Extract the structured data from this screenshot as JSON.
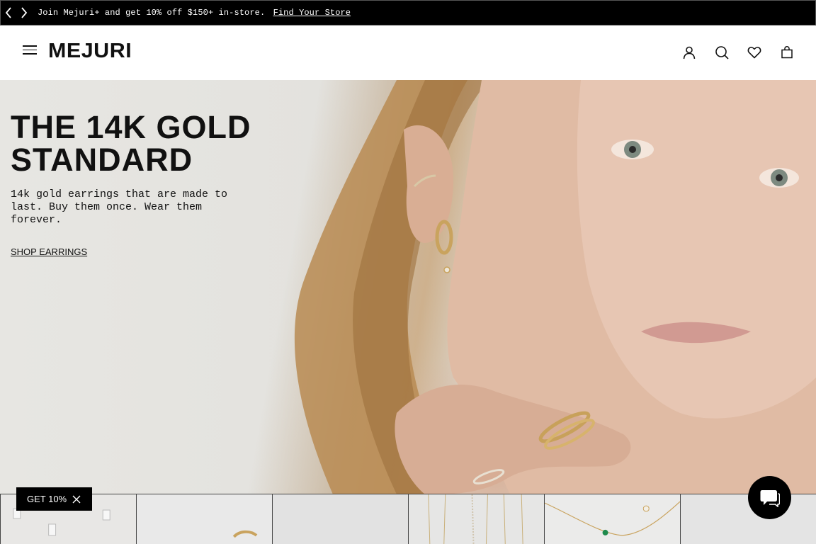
{
  "announcement": {
    "prev_icon": "chevron-left-icon",
    "next_icon": "chevron-right-icon",
    "message": "Join Mejuri+ and get 10% off $150+ in-store.",
    "link_text": "Find Your Store"
  },
  "header": {
    "logo": "MEJURI",
    "icons": [
      "menu-icon",
      "account-icon",
      "search-icon",
      "heart-icon",
      "bag-icon"
    ]
  },
  "hero": {
    "title": "THE 14K GOLD STANDARD",
    "subtitle": "14k gold earrings that are made to last. Buy them once. Wear them forever.",
    "cta": "SHOP EARRINGS"
  },
  "promo": {
    "label": "GET 10%",
    "close_icon": "close-icon"
  },
  "chat": {
    "icon": "chat-icon"
  },
  "colors": {
    "bar": "#000000",
    "text": "#111111",
    "background": "#ffffff"
  }
}
